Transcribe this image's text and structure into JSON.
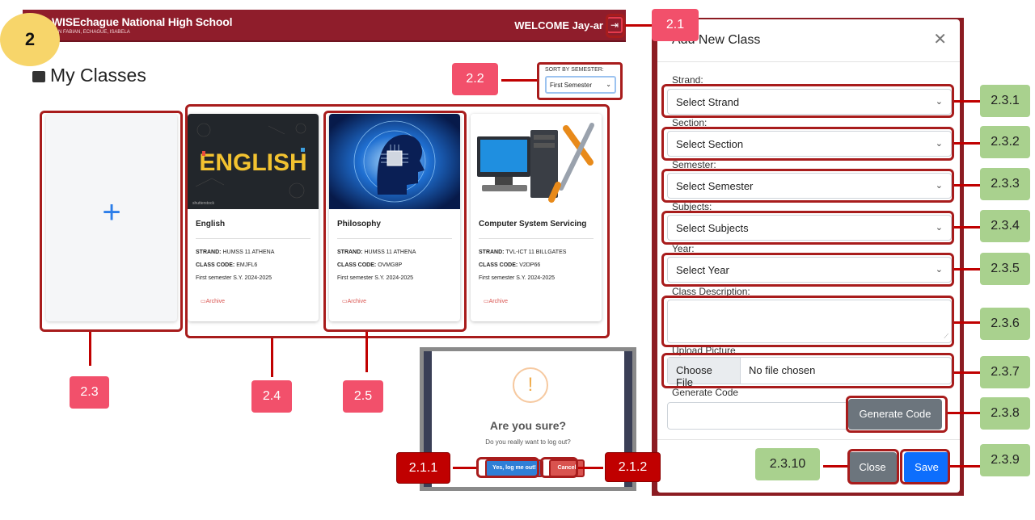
{
  "header": {
    "school_name": "WISEchague National High School",
    "school_address": "SAN FABIAN, ECHAGUE, ISABELA",
    "welcome": "WELCOME Jay-ar"
  },
  "step_number": "2",
  "page": {
    "title": "My Classes",
    "sort_label": "SORT BY SEMESTER:",
    "sort_value": "First Semester"
  },
  "cards": [
    {
      "title": "English",
      "strand_key": "STRAND:",
      "strand": "HUMSS 11 ATHENA",
      "code_key": "CLASS CODE:",
      "code": "EMJFL6",
      "semester": "First semester S.Y. 2024-2025",
      "archive": "Archive",
      "image_text": "ENGLISH"
    },
    {
      "title": "Philosophy",
      "strand_key": "STRAND:",
      "strand": "HUMSS 11 ATHENA",
      "code_key": "CLASS CODE:",
      "code": "OVMG8P",
      "semester": "First semester S.Y. 2024-2025",
      "archive": "Archive"
    },
    {
      "title": "Computer System Servicing",
      "strand_key": "STRAND:",
      "strand": "TVL-ICT 11 BILLGATES",
      "code_key": "CLASS CODE:",
      "code": "V2DP66",
      "semester": "First semester S.Y. 2024-2025",
      "archive": "Archive"
    }
  ],
  "logout_popup": {
    "icon": "!",
    "title": "Are you sure?",
    "message": "Do you really want to log out?",
    "confirm": "Yes, log me out!",
    "cancel": "Cancel"
  },
  "modal": {
    "title": "Add New Class",
    "strand_label": "Strand:",
    "strand_value": "Select Strand",
    "section_label": "Section:",
    "section_value": "Select Section",
    "semester_label": "Semester:",
    "semester_value": "Select Semester",
    "subjects_label": "Subjects:",
    "subjects_value": "Select Subjects",
    "year_label": "Year:",
    "year_value": "Select Year",
    "description_label": "Class Description:",
    "upload_label": "Upload Picture",
    "choose_file": "Choose File",
    "no_file": "No file chosen",
    "generate_label": "Generate Code",
    "generate_button": "Generate Code",
    "close_button": "Close",
    "save_button": "Save"
  },
  "annotations": {
    "t2_1": "2.1",
    "t2_2": "2.2",
    "t2_3": "2.3",
    "t2_4": "2.4",
    "t2_5": "2.5",
    "t2_1_1": "2.1.1",
    "t2_1_2": "2.1.2",
    "t2_3_1": "2.3.1",
    "t2_3_2": "2.3.2",
    "t2_3_3": "2.3.3",
    "t2_3_4": "2.3.4",
    "t2_3_5": "2.3.5",
    "t2_3_6": "2.3.6",
    "t2_3_7": "2.3.7",
    "t2_3_8": "2.3.8",
    "t2_3_9": "2.3.9",
    "t2_3_10": "2.3.10"
  },
  "colors": {
    "header": "#8f1d2b",
    "annotation_red": "#c00000",
    "tag_pink": "#f2506b",
    "tag_green": "#a9d18e",
    "primary": "#0d6efd",
    "step_circle": "#f7d56a"
  }
}
